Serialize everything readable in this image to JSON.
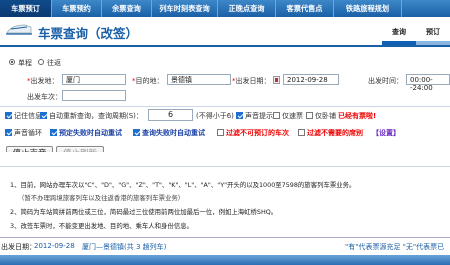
{
  "nav": {
    "tabs": [
      {
        "label": "车票预订",
        "active": true
      },
      {
        "label": "车票预约",
        "active": false
      },
      {
        "label": "余票查询",
        "active": false
      },
      {
        "label": "列车时刻表查询",
        "active": false
      },
      {
        "label": "正晚点查询",
        "active": false
      },
      {
        "label": "客票代售点",
        "active": false
      },
      {
        "label": "铁路旅程规划",
        "active": false
      }
    ]
  },
  "header": {
    "title": "车票查询（改签）",
    "stages": [
      "查询",
      "预订"
    ]
  },
  "form": {
    "trip_type": {
      "one_way": "单程",
      "round_trip": "往返",
      "selected": "one_way"
    },
    "from_label": "*出发地：",
    "from_value": "厦门",
    "to_label": "*目的地：",
    "to_value": "景德镇",
    "date_label": "*出发日期：",
    "date_value": "2012-09-28",
    "time_label": "出发时间：",
    "time_value": "00:00--24:00",
    "train_label": "出发车次：",
    "train_value": "",
    "remember": "记住信息",
    "auto_requery": "自动重新查询，查询周期(S)：",
    "period_value": "6",
    "period_hint": "(不得小于6)",
    "sound_alert": "声音提示",
    "only_stop": "仅速票",
    "only_sleeper": "仅卧铺",
    "tickets_hint": "已经有票啦!",
    "sound_loop": "声音循环",
    "book_auto_retry": "预定失败时自动重试",
    "query_auto_retry": "查询失败时自动重试",
    "filter_not_bookable": "过滤不可预订的车次",
    "filter_unwanted": "过滤不需要的席别",
    "settings_link": "【设置】",
    "stop_sound": "停止声音",
    "stop_refresh": "停止刷新"
  },
  "notices": [
    "1、目前，网站办理车次以\"C\"、\"D\"、\"G\"、\"Z\"、\"T\"、\"K\"、\"L\"、\"A\"、\"Y\"开头的以及1000至7598的旅客列车票业务。",
    "（暂不办理跨境旅客列车以及往返香港的旅客列车票业务）",
    "2、简码为车站简拼前两位或三位，简码最过三位使用前两位加最后一位，例如上海虹桥SHQ。",
    "3、改签车票时，不能变更出发地、目的地、乘车人和身份信息。"
  ],
  "result": {
    "prefix": "出发日期：",
    "date": "2012-09-28",
    "route": "厦门—景德镇(共 3 趟列车)",
    "legend": "\"有\"代表票源充足 \"无\"代表票已"
  },
  "colors": {
    "nav": "#1a5fa6",
    "accent": "#1f6fd0",
    "warn": "#e00000"
  }
}
